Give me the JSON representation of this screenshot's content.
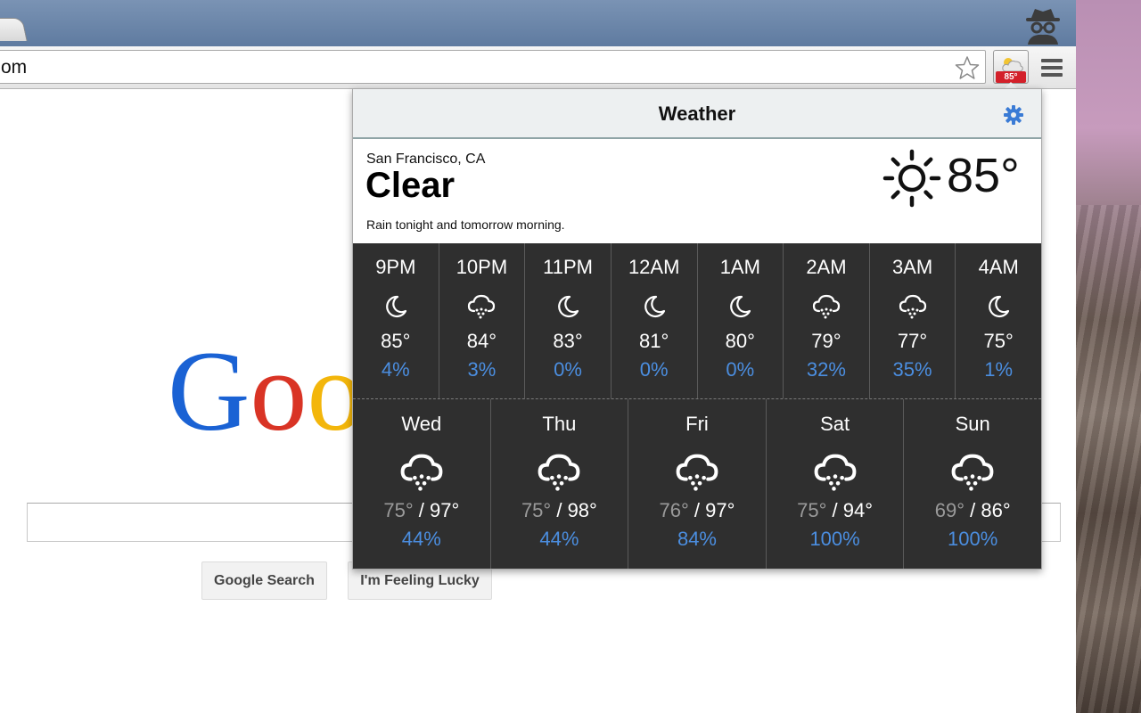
{
  "browser": {
    "url_fragment": "om",
    "extension_badge": "85°"
  },
  "google": {
    "logo_visible": "Goo",
    "search_button": "Google Search",
    "lucky_button": "I'm Feeling Lucky"
  },
  "weather": {
    "title": "Weather",
    "city": "San Francisco, CA",
    "condition": "Clear",
    "summary": "Rain tonight and tomorrow morning.",
    "current_temp": "85°",
    "current_icon": "sun-icon",
    "hourly": [
      {
        "time": "9PM",
        "icon": "moon",
        "temp": "85°",
        "pop": "4%"
      },
      {
        "time": "10PM",
        "icon": "rain",
        "temp": "84°",
        "pop": "3%"
      },
      {
        "time": "11PM",
        "icon": "moon",
        "temp": "83°",
        "pop": "0%"
      },
      {
        "time": "12AM",
        "icon": "moon",
        "temp": "81°",
        "pop": "0%"
      },
      {
        "time": "1AM",
        "icon": "moon",
        "temp": "80°",
        "pop": "0%"
      },
      {
        "time": "2AM",
        "icon": "rain",
        "temp": "79°",
        "pop": "32%"
      },
      {
        "time": "3AM",
        "icon": "rain",
        "temp": "77°",
        "pop": "35%"
      },
      {
        "time": "4AM",
        "icon": "moon",
        "temp": "75°",
        "pop": "1%"
      }
    ],
    "daily": [
      {
        "day": "Wed",
        "icon": "rain",
        "low": "75°",
        "high": "97°",
        "pop": "44%"
      },
      {
        "day": "Thu",
        "icon": "rain",
        "low": "75°",
        "high": "98°",
        "pop": "44%"
      },
      {
        "day": "Fri",
        "icon": "rain",
        "low": "76°",
        "high": "97°",
        "pop": "84%"
      },
      {
        "day": "Sat",
        "icon": "rain",
        "low": "75°",
        "high": "94°",
        "pop": "100%"
      },
      {
        "day": "Sun",
        "icon": "rain",
        "low": "69°",
        "high": "86°",
        "pop": "100%"
      }
    ]
  },
  "colors": {
    "accent_blue": "#4b8ee0",
    "panel_dark": "#2f2f2f",
    "badge_red": "#d3202a"
  }
}
